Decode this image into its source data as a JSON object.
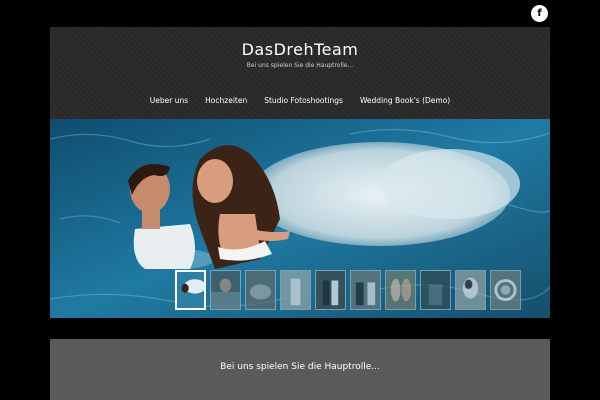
{
  "social": {
    "facebook_glyph": "f",
    "icon": "facebook-icon"
  },
  "header": {
    "site_title": "DasDrehTeam",
    "tagline": "Bei uns spielen Sie die Hauptrolle..."
  },
  "nav": {
    "items": [
      {
        "label": "Ueber uns"
      },
      {
        "label": "Hochzeiten"
      },
      {
        "label": "Studio Fotoshootings"
      },
      {
        "label": "Wedding Book's (Demo)"
      }
    ]
  },
  "slider": {
    "thumbnail_count": 10,
    "active_index": 0
  },
  "content": {
    "heading": "Bei uns spielen Sie die Hauptrolle..."
  },
  "colors": {
    "page_background": "#000000",
    "header_background": "#2a2a2a",
    "content_background": "#5a5a5a",
    "water": "#1f7aa3"
  }
}
